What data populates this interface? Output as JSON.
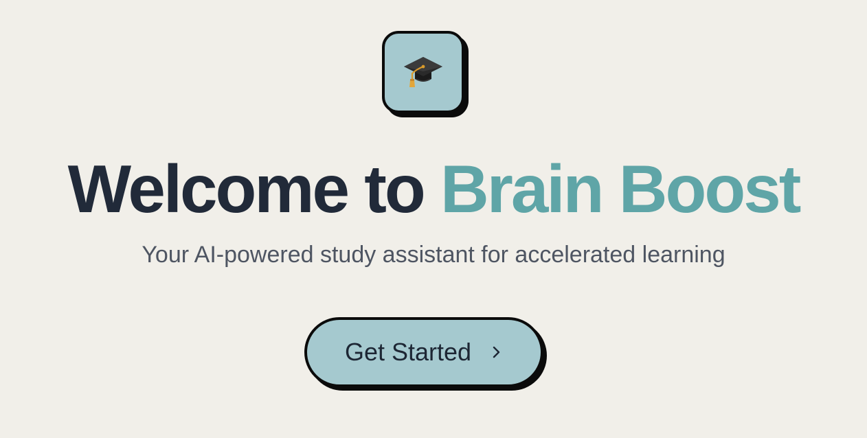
{
  "logo": {
    "icon": "graduation-cap-icon",
    "background": "#a5c9cf"
  },
  "hero": {
    "title_prefix": "Welcome to ",
    "title_accent": "Brain Boost",
    "subtitle": "Your AI-powered study assistant for accelerated learning"
  },
  "cta": {
    "label": "Get Started",
    "icon": "chevron-right-icon"
  },
  "colors": {
    "background": "#f1efe9",
    "title": "#212a39",
    "accent": "#5fa5a7",
    "button": "#a5c9cf",
    "subtitle": "#4e5562"
  }
}
